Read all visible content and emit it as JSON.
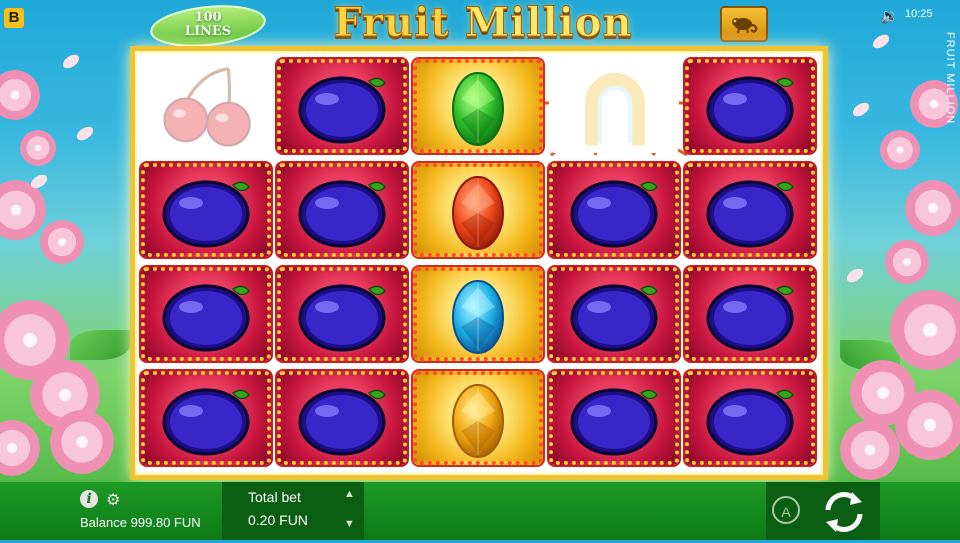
{
  "brand": {
    "logo_letter": "B"
  },
  "header": {
    "lines_top": "100",
    "lines_bottom": "LINES",
    "title_main": "Fruit",
    "title_sub": "Million",
    "sound_icon": "speaker-icon",
    "time": "10:25",
    "side_title": "FRUIT MILLION",
    "menu_icon": "chameleon-icon"
  },
  "reels": {
    "columns": 5,
    "rows": 4,
    "grid": [
      [
        "cherries",
        "plum",
        "emerald",
        "horseshoe",
        "plum"
      ],
      [
        "plum",
        "plum",
        "ruby",
        "plum",
        "plum"
      ],
      [
        "plum",
        "plum",
        "sapphire",
        "plum",
        "plum"
      ],
      [
        "plum",
        "plum",
        "topaz",
        "plum",
        "plum"
      ]
    ],
    "highlight": [
      [
        false,
        true,
        true,
        false,
        true
      ],
      [
        true,
        true,
        true,
        true,
        true
      ],
      [
        true,
        true,
        true,
        true,
        true
      ],
      [
        true,
        true,
        true,
        true,
        true
      ]
    ],
    "colors": {
      "frame_gold": "#f0c334",
      "cell_red": "#c6153e",
      "cell_gold": "#f3b71c",
      "win_line": "#e8551a"
    }
  },
  "footer": {
    "info_icon": "info-icon",
    "settings_icon": "gear-icon",
    "balance_label": "Balance",
    "balance_value": "999.80 FUN",
    "total_bet_label": "Total bet",
    "total_bet_value": "0.20 FUN",
    "autoplay_label": "A",
    "spin_icon": "spin-arrows-icon"
  }
}
